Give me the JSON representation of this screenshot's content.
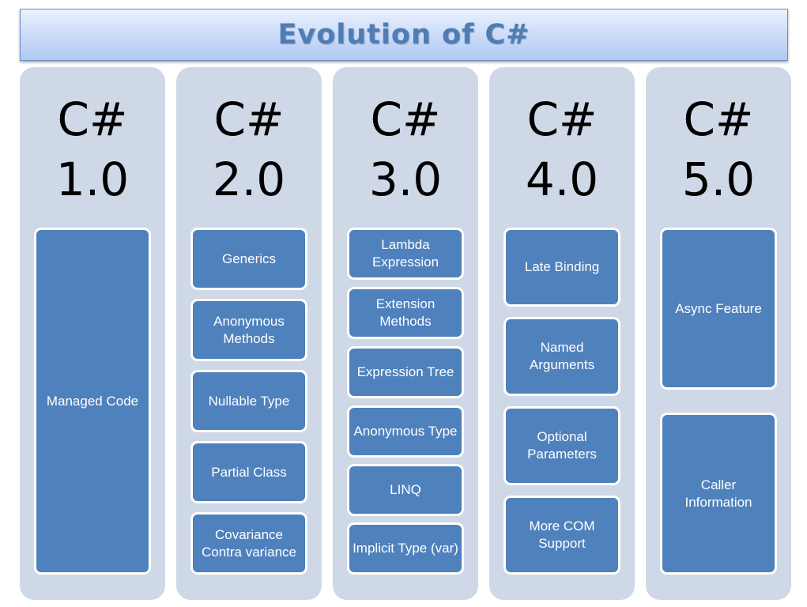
{
  "title": "Evolution of C#",
  "columns": [
    {
      "name": "C#",
      "version": "1.0",
      "features": [
        "Managed Code"
      ]
    },
    {
      "name": "C#",
      "version": "2.0",
      "features": [
        "Generics",
        "Anonymous Methods",
        "Nullable Type",
        "Partial Class",
        "Covariance Contra variance"
      ]
    },
    {
      "name": "C#",
      "version": "3.0",
      "features": [
        "Lambda Expression",
        "Extension Methods",
        "Expression Tree",
        "Anonymous Type",
        "LINQ",
        "Implicit Type (var)"
      ]
    },
    {
      "name": "C#",
      "version": "4.0",
      "features": [
        "Late Binding",
        "Named Arguments",
        "Optional Parameters",
        "More COM Support"
      ]
    },
    {
      "name": "C#",
      "version": "5.0",
      "features": [
        "Async Feature",
        "Caller Information"
      ]
    }
  ],
  "colors": {
    "column_bg": "#cfd8e6",
    "feature_bg": "#4f81bd",
    "title_text": "#4f7db3"
  }
}
